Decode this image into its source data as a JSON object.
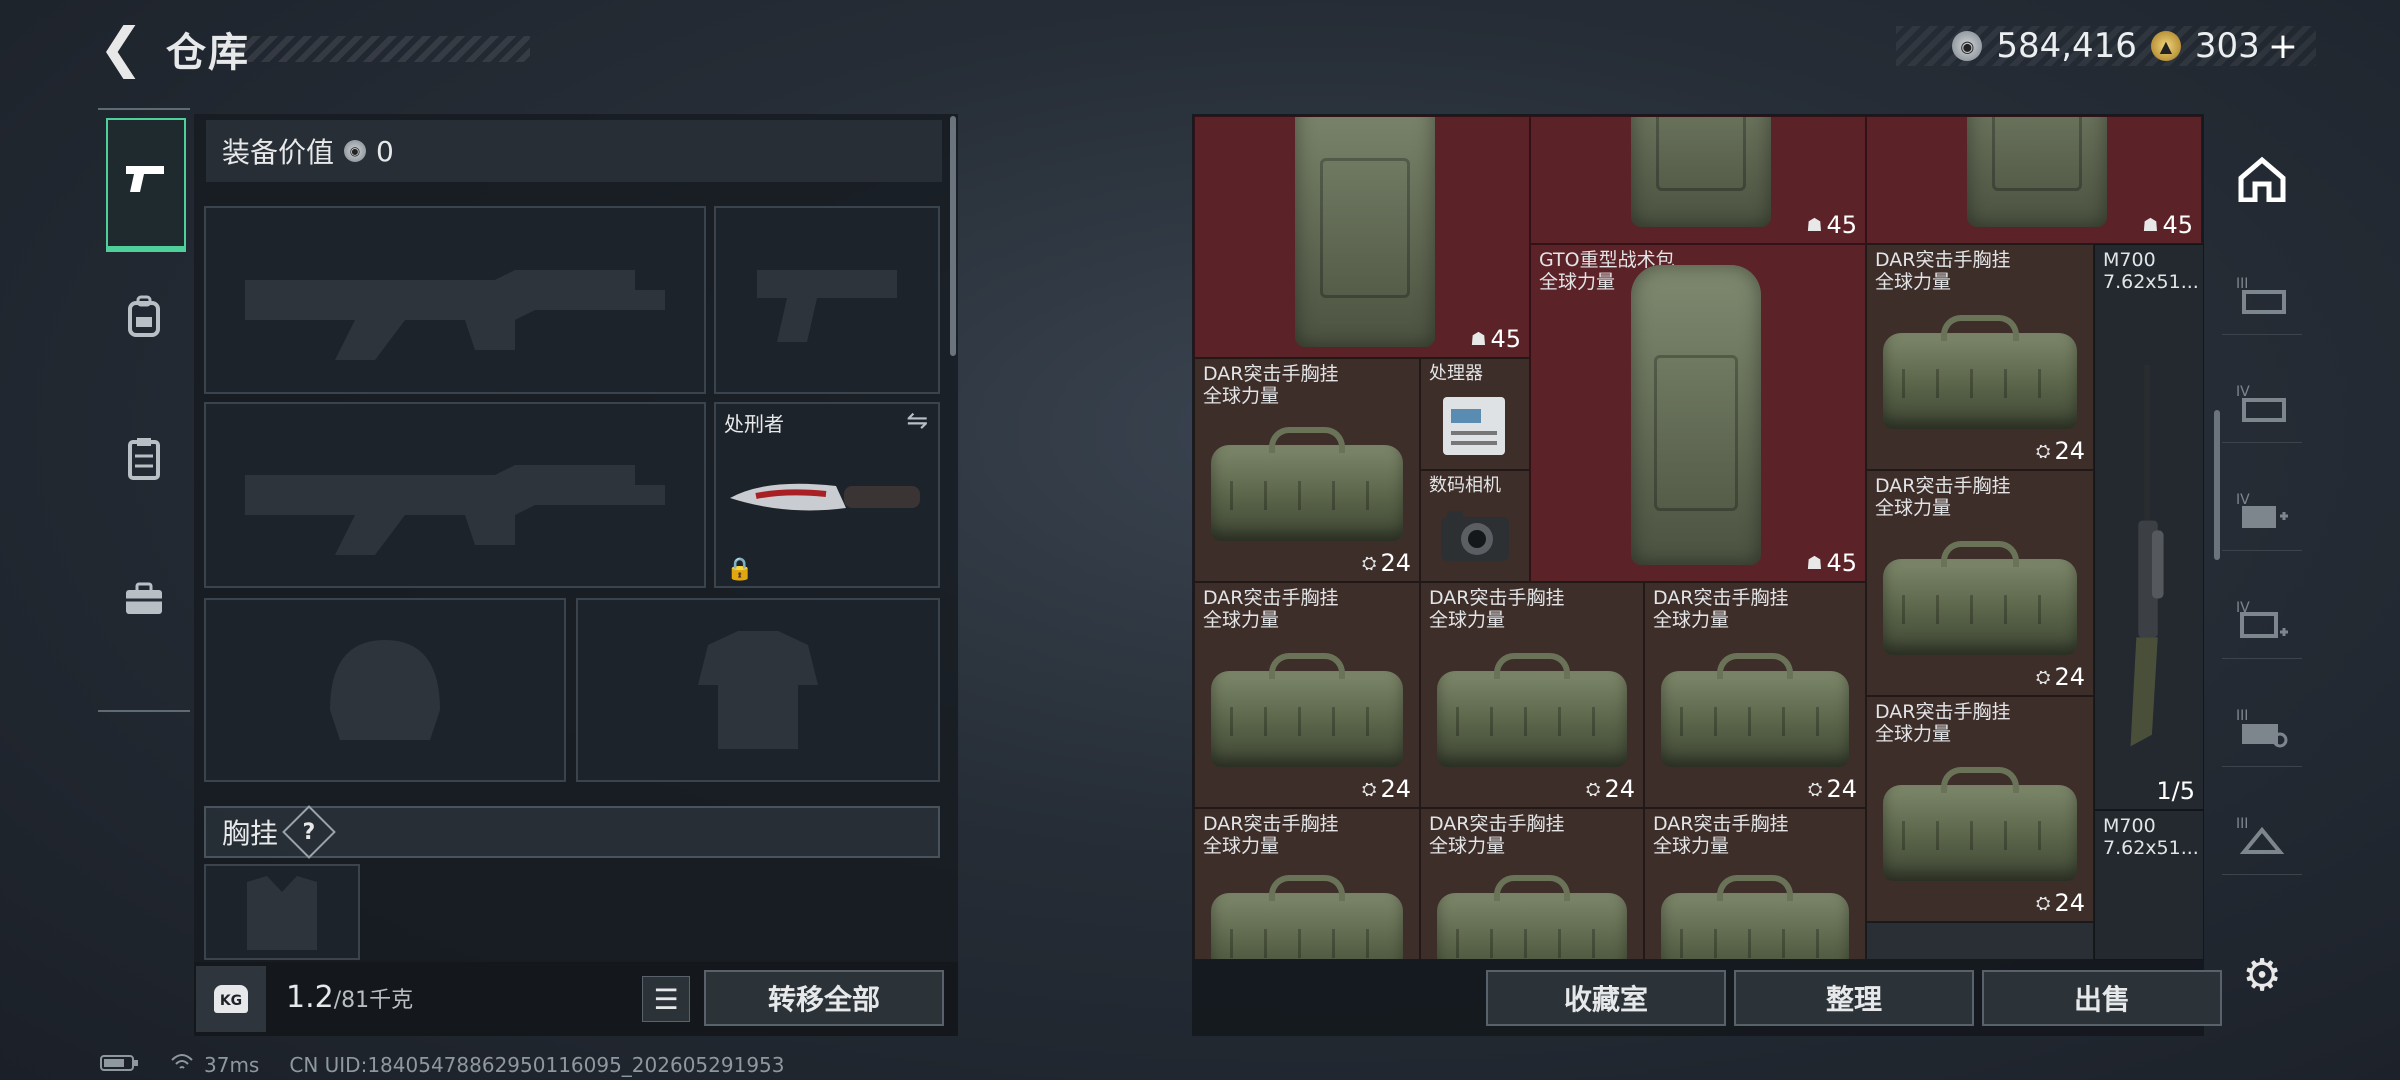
{
  "header": {
    "title": "仓库"
  },
  "currency": {
    "silver": "584,416",
    "gold": "303",
    "plus": "+"
  },
  "equipment": {
    "label": "装备价值",
    "value": "0",
    "knife_name": "处刑者",
    "chest_label": "胸挂",
    "help": "?"
  },
  "footer_left": {
    "weight_current": "1.2",
    "weight_max": "/81千克",
    "weight_badge": "KG",
    "transfer_all": "转移全部"
  },
  "grid": {
    "top_counts": [
      "45",
      "45",
      "45",
      "45"
    ],
    "gto": {
      "name": "GTO重型战术包",
      "sub": "全球力量",
      "count": "45"
    },
    "processor": "处理器",
    "camera": "数码相机",
    "dar_name": "DAR突击手胸挂",
    "dar_sub": "全球力量",
    "dar_count": "24",
    "m700": {
      "name": "M700",
      "caliber": "7.62x51...",
      "ammo": "1/5"
    }
  },
  "actions": {
    "collection": "收藏室",
    "organize": "整理",
    "sell": "出售"
  },
  "status": {
    "ping": "37ms",
    "uid": "CN UID:18405478862950116095_202605291953"
  },
  "colors": {
    "accent": "#4fcf9a",
    "red_cell": "#5b2228",
    "brown_cell": "#3d2e2a"
  }
}
